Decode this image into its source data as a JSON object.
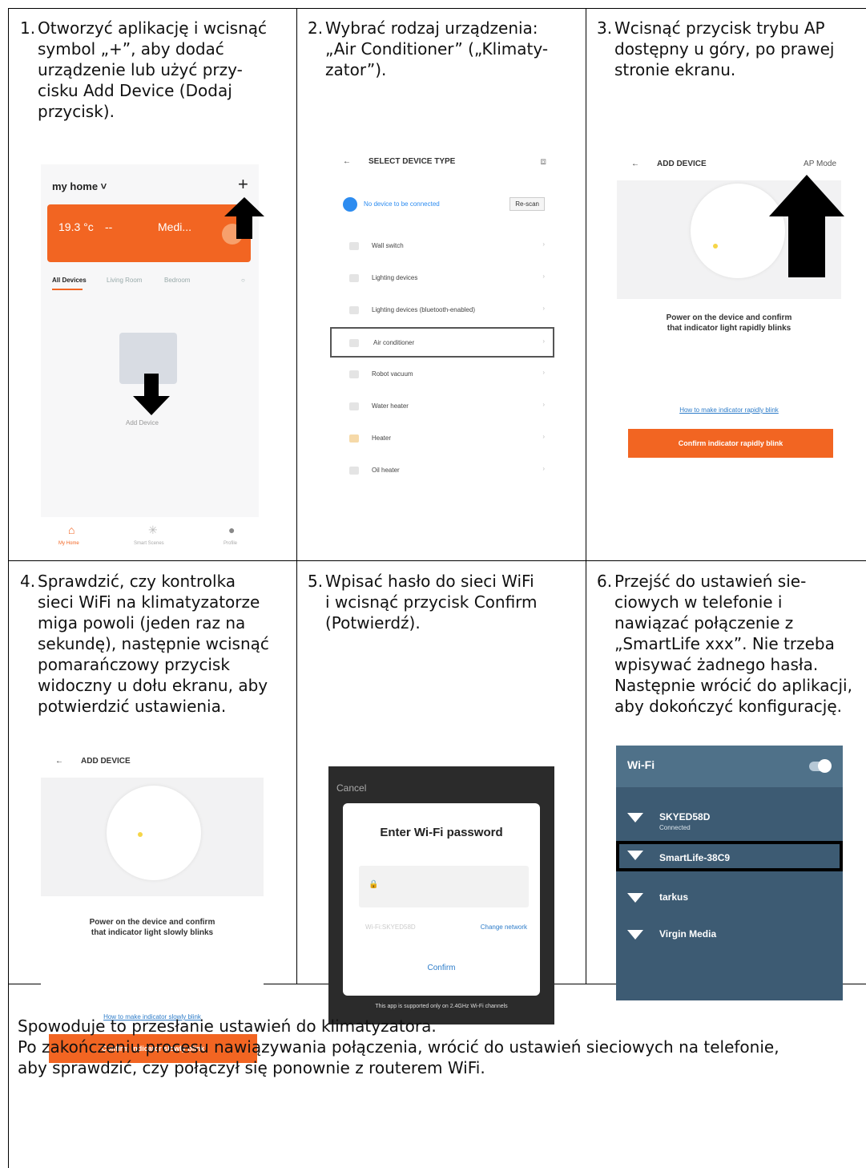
{
  "steps": [
    {
      "num": "1.",
      "text": "Otworzyć aplikację i wcisnąć\nsymbol „+”, aby dodać\nurządzenie lub użyć przy-\ncisku Add Device (Dodaj\nprzycisk)."
    },
    {
      "num": "2.",
      "text": "Wybrać rodzaj urządzenia:\n„Air Conditioner” („Klimaty-\nzator”)."
    },
    {
      "num": "3.",
      "text": "Wcisnąć przycisk trybu AP\ndostępny u góry, po prawej\nstronie ekranu."
    },
    {
      "num": "4.",
      "text": "Sprawdzić, czy kontrolka\nsieci WiFi na klimatyzatorze\nmiga powoli (jeden raz na\nsekundę), następnie wcisnąć\npomarańczowy przycisk\nwidoczny u dołu ekranu, aby\npotwierdzić ustawienia."
    },
    {
      "num": "5.",
      "text": "Wpisać hasło do sieci WiFi\ni wcisnąć przycisk Confirm\n(Potwierdź)."
    },
    {
      "num": "6.",
      "text": "Przejść do ustawień sie-\nciowych w telefonie i\nnawiązać połączenie z\n„SmartLife xxx”. Nie trzeba\nwpisywać żadnego hasła.\nNastępnie wrócić do aplikacji,\naby dokończyć konfigurację."
    }
  ],
  "screen1": {
    "home": "my home ˅",
    "plus": "+",
    "temp": "19.3 °c",
    "dash": "--",
    "medi": "Medi...",
    "tabs": [
      "All Devices",
      "Living Room",
      "Bedroom"
    ],
    "add_device": "Add Device",
    "nav": [
      "My Home",
      "Smart Scenes",
      "Profile"
    ]
  },
  "screen2": {
    "title": "SELECT DEVICE TYPE",
    "status": "No device to be connected",
    "rescan": "Re-scan",
    "items": [
      "Wall switch",
      "Lighting devices",
      "Lighting devices (bluetooth-enabled)",
      "Air conditioner",
      "Robot vacuum",
      "Water heater",
      "Heater",
      "Oil heater"
    ]
  },
  "screen3": {
    "title": "ADD DEVICE",
    "ap_mode": "AP Mode",
    "message": "Power on the device and confirm\nthat indicator light rapidly blinks",
    "link": "How to make indicator rapidly blink",
    "button": "Confirm indicator rapidly blink"
  },
  "screen4": {
    "title": "ADD DEVICE",
    "message": "Power on the device and confirm\nthat indicator light slowly blinks",
    "link": "How to make indicator slowly blink",
    "button": "Confirm indicator slowly blink"
  },
  "screen5": {
    "cancel": "Cancel",
    "title": "Enter Wi-Fi password",
    "ssid": "Wi-Fi:SKYED58D",
    "change": "Change network",
    "confirm": "Confirm",
    "footer": "This app is supported only on 2.4GHz Wi-Fi channels"
  },
  "screen6": {
    "title": "Wi-Fi",
    "networks": [
      {
        "name": "SKYED58D",
        "sub": "Connected"
      },
      {
        "name": "SmartLife-38C9",
        "sub": ""
      },
      {
        "name": "tarkus",
        "sub": ""
      },
      {
        "name": "Virgin Media",
        "sub": ""
      }
    ]
  },
  "footer": "Spowoduje to przesłanie ustawień do klimatyzatora.\nPo zakończeniu procesu nawiązywania połączenia, wrócić do ustawień sieciowych na telefonie,\naby sprawdzić, czy połączył się ponownie z routerem WiFi.",
  "colors": {
    "accent": "#f26522",
    "link": "#2d7cc9",
    "wifi_bg": "#3d5b73"
  }
}
